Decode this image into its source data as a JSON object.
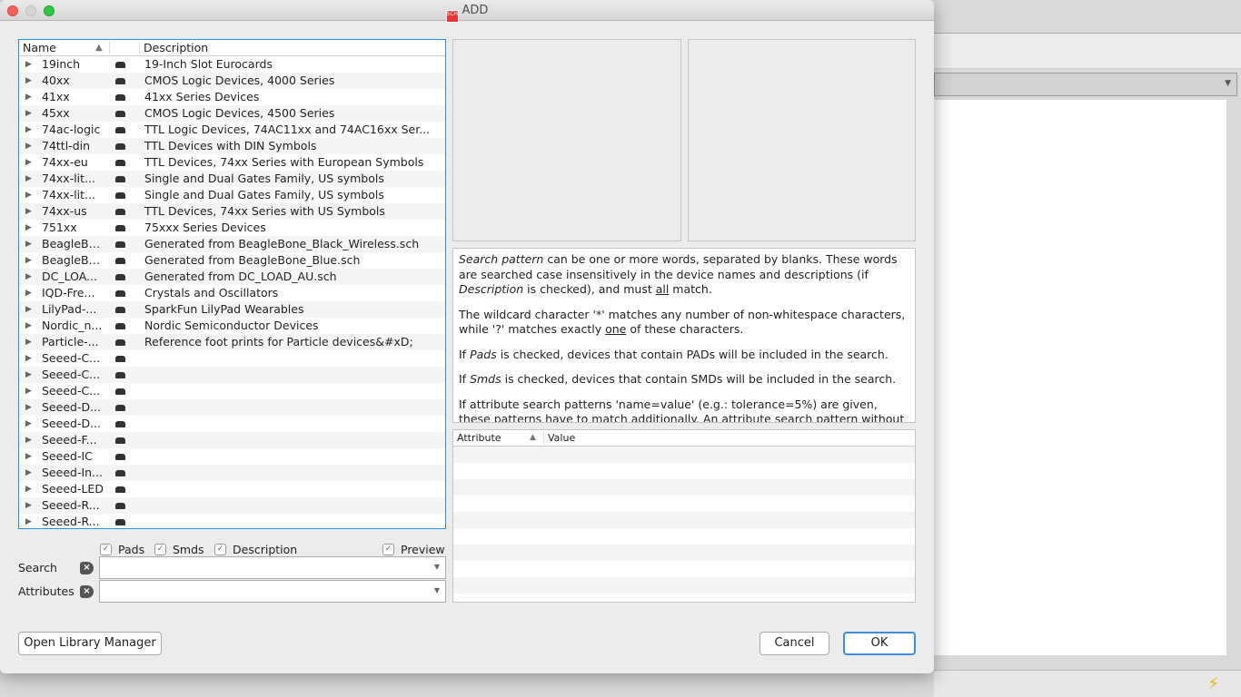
{
  "window": {
    "title": "ADD",
    "icon": "sch-icon"
  },
  "tree": {
    "columns": [
      "Name",
      "Description"
    ],
    "rows": [
      {
        "name": "19inch",
        "desc": "19-Inch Slot Eurocards"
      },
      {
        "name": "40xx",
        "desc": "CMOS Logic Devices, 4000 Series"
      },
      {
        "name": "41xx",
        "desc": "41xx Series Devices"
      },
      {
        "name": "45xx",
        "desc": "CMOS Logic Devices, 4500 Series"
      },
      {
        "name": "74ac-logic",
        "desc": "TTL Logic Devices, 74AC11xx and 74AC16xx Ser..."
      },
      {
        "name": "74ttl-din",
        "desc": "TTL Devices with DIN Symbols"
      },
      {
        "name": "74xx-eu",
        "desc": "TTL Devices, 74xx Series with European Symbols"
      },
      {
        "name": "74xx-lit...",
        "desc": "Single and Dual Gates Family, US symbols"
      },
      {
        "name": "74xx-lit...",
        "desc": "Single and Dual Gates Family, US symbols"
      },
      {
        "name": "74xx-us",
        "desc": "TTL Devices, 74xx Series with US Symbols"
      },
      {
        "name": "751xx",
        "desc": "75xxx Series Devices"
      },
      {
        "name": "BeagleBo...",
        "desc": "Generated from BeagleBone_Black_Wireless.sch"
      },
      {
        "name": "BeagleBo...",
        "desc": "Generated from BeagleBone_Blue.sch"
      },
      {
        "name": "DC_LOA...",
        "desc": "Generated from DC_LOAD_AU.sch"
      },
      {
        "name": "IQD-Fre...",
        "desc": "Crystals and Oscillators"
      },
      {
        "name": "LilyPad-...",
        "desc": "SparkFun LilyPad Wearables"
      },
      {
        "name": "Nordic_n...",
        "desc": "Nordic Semiconductor Devices"
      },
      {
        "name": "Particle-...",
        "desc": "Reference foot prints for Particle devices&#xD;"
      },
      {
        "name": "Seeed-C...",
        "desc": ""
      },
      {
        "name": "Seeed-C...",
        "desc": ""
      },
      {
        "name": "Seeed-C...",
        "desc": ""
      },
      {
        "name": "Seeed-D...",
        "desc": ""
      },
      {
        "name": "Seeed-D...",
        "desc": ""
      },
      {
        "name": "Seeed-F...",
        "desc": ""
      },
      {
        "name": "Seeed-IC",
        "desc": ""
      },
      {
        "name": "Seeed-In...",
        "desc": ""
      },
      {
        "name": "Seeed-LED",
        "desc": ""
      },
      {
        "name": "Seeed-R...",
        "desc": ""
      },
      {
        "name": "Seeed-R...",
        "desc": ""
      }
    ]
  },
  "options": {
    "pads": "Pads",
    "smds": "Smds",
    "description": "Description",
    "preview": "Preview"
  },
  "checked": {
    "pads": true,
    "smds": true,
    "description": true,
    "preview": true
  },
  "search": {
    "label": "Search",
    "value": ""
  },
  "attributes": {
    "label": "Attributes",
    "value": ""
  },
  "help": [
    [
      {
        "t": "Search pattern",
        "s": "i"
      },
      {
        "t": " can be one or more words, separated by blanks. These words are searched case insensitively in the device names and descriptions (if "
      },
      {
        "t": "Description",
        "s": "i"
      },
      {
        "t": " is checked), and must "
      },
      {
        "t": "all",
        "s": "u"
      },
      {
        "t": " match."
      }
    ],
    [
      {
        "t": "The wildcard character '*' matches any number of non-whitespace characters, while '?' matches exactly "
      },
      {
        "t": "one",
        "s": "u"
      },
      {
        "t": " of these characters."
      }
    ],
    [
      {
        "t": "If "
      },
      {
        "t": "Pads",
        "s": "i"
      },
      {
        "t": " is checked, devices that contain PADs will be included in the search."
      }
    ],
    [
      {
        "t": "If "
      },
      {
        "t": "Smds",
        "s": "i"
      },
      {
        "t": " is checked, devices that contain SMDs will be included in the search."
      }
    ],
    [
      {
        "t": "If attribute search patterns 'name=value' (e.g.: tolerance=5%) are given, these patterns have to match additionally. An attribute search pattern without the"
      }
    ]
  ],
  "attr_table": {
    "columns": [
      "Attribute",
      "Value"
    ]
  },
  "buttons": {
    "library_manager": "Open Library Manager",
    "cancel": "Cancel",
    "ok": "OK"
  }
}
